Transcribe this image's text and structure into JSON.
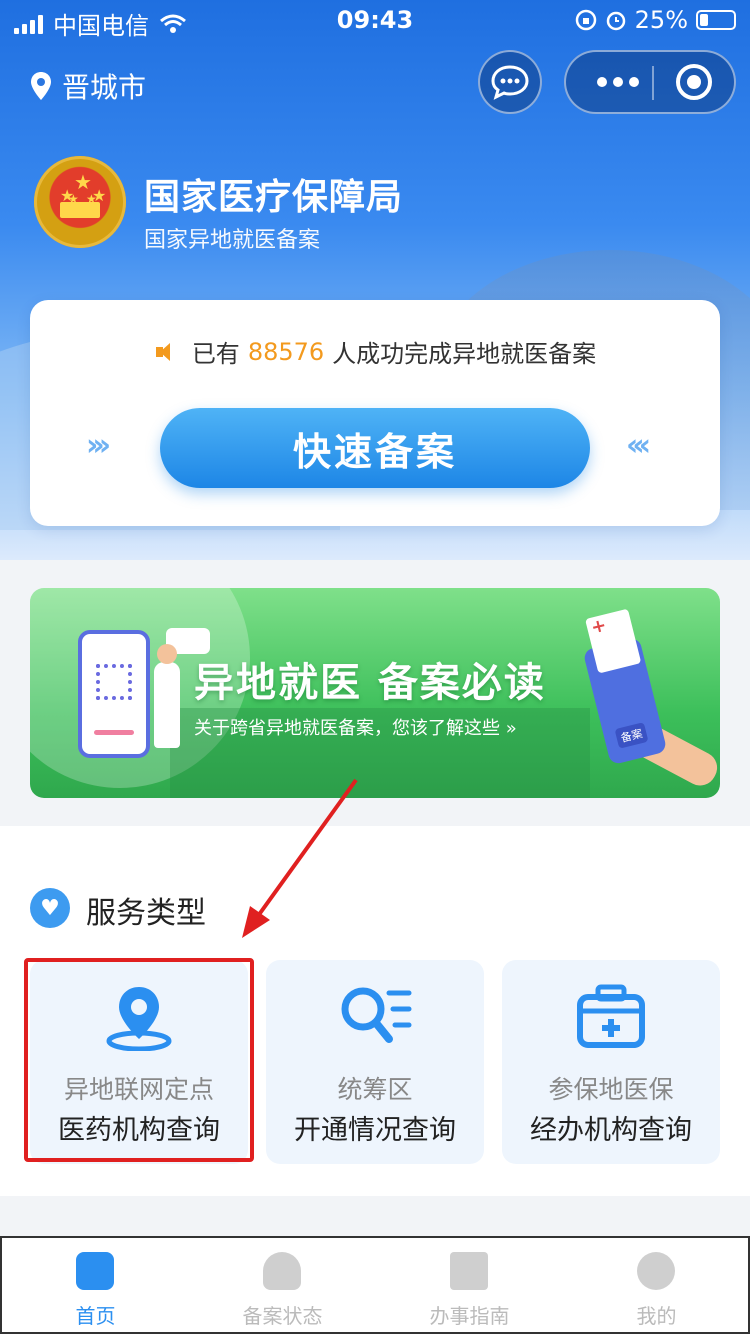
{
  "status_bar": {
    "carrier": "中国电信",
    "time": "09:43",
    "battery": "25%"
  },
  "header": {
    "location": "晋城市",
    "org_name": "国家医疗保障局",
    "org_subtitle": "国家异地就医备案"
  },
  "notice": {
    "prefix": "已有",
    "count": "88576",
    "suffix": "人成功完成异地就医备案"
  },
  "quick_button": "快速备案",
  "banner": {
    "title": "异地就医 备案必读",
    "subtitle": "关于跨省异地就医备案，您该了解这些 »",
    "tag": "备案"
  },
  "services": {
    "title": "服务类型",
    "items": [
      {
        "line1": "异地联网定点",
        "line2": "医药机构查询",
        "icon": "location-pin-icon"
      },
      {
        "line1": "统筹区",
        "line2": "开通情况查询",
        "icon": "search-list-icon"
      },
      {
        "line1": "参保地医保",
        "line2": "经办机构查询",
        "icon": "medical-kit-icon"
      }
    ]
  },
  "tabbar": {
    "items": [
      {
        "label": "首页",
        "active": true
      },
      {
        "label": "备案状态",
        "active": false
      },
      {
        "label": "办事指南",
        "active": false
      },
      {
        "label": "我的",
        "active": false
      }
    ]
  },
  "colors": {
    "primary": "#2b8ff0",
    "accent_number": "#f39a1e",
    "highlight_box": "#e02020"
  }
}
